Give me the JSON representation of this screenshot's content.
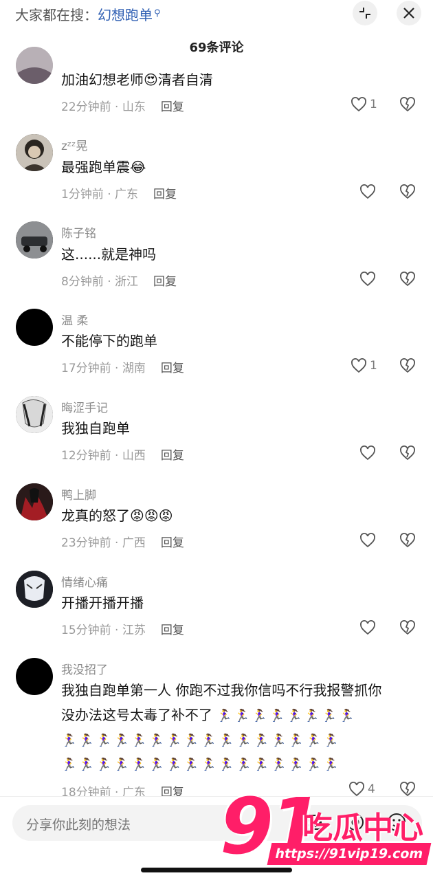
{
  "header": {
    "search_hint_prefix": "大家都在搜：",
    "search_keyword": "幻想跑单",
    "collapse_icon": "collapse-icon",
    "close_icon": "close-icon"
  },
  "comment_count_title": "69条评论",
  "comments": [
    {
      "nick": "",
      "text": "加油幻想老师😍清者自清",
      "time": "22分钟前",
      "location": "山东",
      "reply": "回复",
      "likes": "1"
    },
    {
      "nick": "zᶻᶻ晃",
      "text": "最强跑单震😂",
      "time": "1分钟前",
      "location": "广东",
      "reply": "回复",
      "likes": ""
    },
    {
      "nick": "陈子铭",
      "text": "这......就是神吗",
      "time": "8分钟前",
      "location": "浙江",
      "reply": "回复",
      "likes": ""
    },
    {
      "nick": "温 柔",
      "text": "不能停下的跑单",
      "time": "17分钟前",
      "location": "湖南",
      "reply": "回复",
      "likes": "1"
    },
    {
      "nick": "晦涩手记",
      "text": "我独自跑单",
      "time": "12分钟前",
      "location": "山西",
      "reply": "回复",
      "likes": ""
    },
    {
      "nick": "鸭上脚",
      "text": "龙真的怒了😡😡😡",
      "time": "23分钟前",
      "location": "广西",
      "reply": "回复",
      "likes": ""
    },
    {
      "nick": "情绪心痛",
      "text": "开播开播开播",
      "time": "15分钟前",
      "location": "江苏",
      "reply": "回复",
      "likes": ""
    },
    {
      "nick": "我没招了",
      "text_line1": "我独自跑单第一人 你跑不过我你信吗不行我报警抓你",
      "text_line2": "没办法这号太毒了补不了",
      "runners_line2": "🏃‍♀️🏃‍♀️🏃‍♀️🏃‍♀️🏃‍♀️🏃‍♀️🏃‍♀️🏃‍♀️",
      "runners_line3": "🏃‍♀️🏃‍♀️🏃‍♀️🏃‍♀️🏃‍♀️🏃‍♀️🏃‍♀️🏃‍♀️🏃‍♀️🏃‍♀️🏃‍♀️🏃‍♀️🏃‍♀️🏃‍♀️🏃‍♀️🏃‍♀️",
      "runners_line4": "🏃‍♀️🏃‍♀️🏃‍♀️🏃‍♀️🏃‍♀️🏃‍♀️🏃‍♀️🏃‍♀️🏃‍♀️🏃‍♀️🏃‍♀️🏃‍♀️🏃‍♀️🏃‍♀️🏃‍♀️🏃‍♀️",
      "time": "18分钟前",
      "location": "广东",
      "reply": "回复",
      "likes": "4"
    }
  ],
  "meta_separator": " · ",
  "input": {
    "placeholder": "分享你此刻的想法"
  },
  "watermark": {
    "number": "91",
    "brand": "吃瓜中心",
    "url": "https://91vip19.com"
  }
}
